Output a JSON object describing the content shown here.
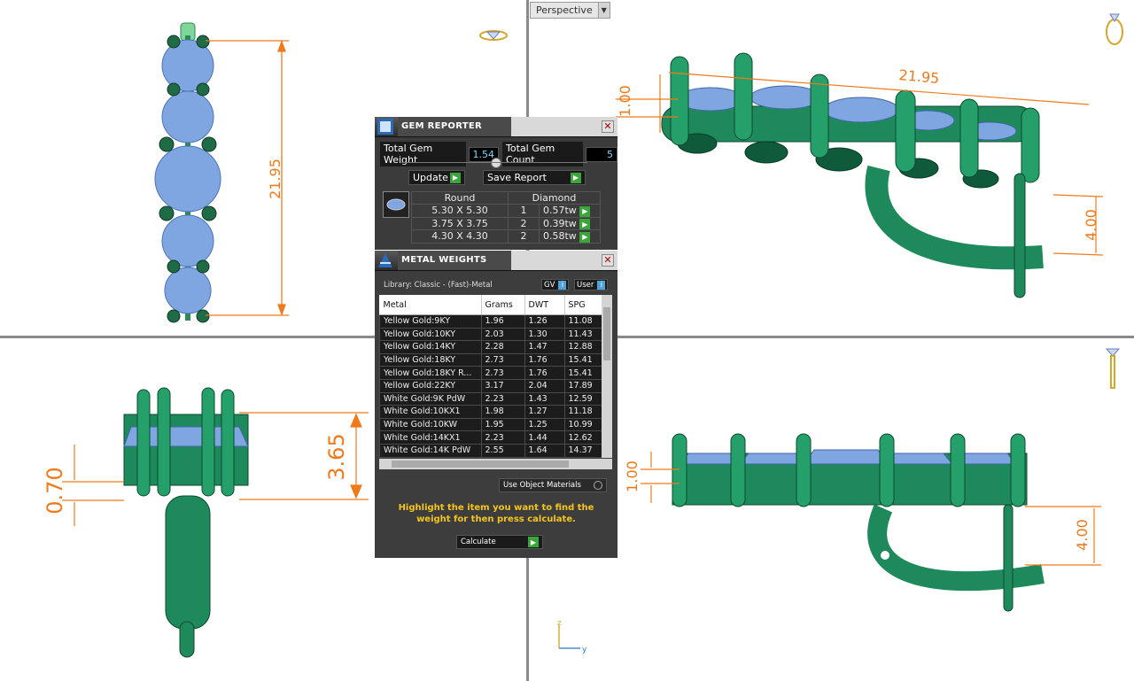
{
  "viewport_label": "Perspective",
  "dimensions": {
    "top_length": "21.95",
    "persp_length": "21.95",
    "persp_small": "1.00",
    "persp_right": "4.00",
    "side_left": "0.70",
    "side_right": "3.65",
    "front_small": "1.00",
    "front_right": "4.00"
  },
  "axis": {
    "z": "z",
    "y": "y"
  },
  "gem_reporter": {
    "title": "GEM REPORTER",
    "total_weight_label": "Total Gem Weight",
    "total_weight": "1.54",
    "total_count_label": "Total Gem Count",
    "total_count": "5",
    "update_label": "Update",
    "save_label": "Save Report",
    "shape": "Round",
    "material": "Diamond",
    "rows": [
      {
        "size": "5.30 X 5.30",
        "qty": "1",
        "weight": "0.57tw"
      },
      {
        "size": "3.75 X 3.75",
        "qty": "2",
        "weight": "0.39tw"
      },
      {
        "size": "4.30 X 4.30",
        "qty": "2",
        "weight": "0.58tw"
      }
    ]
  },
  "metal_weights": {
    "title": "METAL WEIGHTS",
    "library": "Library: Classic - (Fast)-Metal",
    "gv_label": "GV",
    "user_label": "User",
    "columns": [
      "Metal",
      "Grams",
      "DWT",
      "SPG"
    ],
    "rows": [
      [
        "Yellow Gold:9KY",
        "1.96",
        "1.26",
        "11.08"
      ],
      [
        "Yellow Gold:10KY",
        "2.03",
        "1.30",
        "11.43"
      ],
      [
        "Yellow Gold:14KY",
        "2.28",
        "1.47",
        "12.88"
      ],
      [
        "Yellow Gold:18KY",
        "2.73",
        "1.76",
        "15.41"
      ],
      [
        "Yellow Gold:18KY R...",
        "2.73",
        "1.76",
        "15.41"
      ],
      [
        "Yellow Gold:22KY",
        "3.17",
        "2.04",
        "17.89"
      ],
      [
        "White Gold:9K PdW",
        "2.23",
        "1.43",
        "12.59"
      ],
      [
        "White Gold:10KX1",
        "1.98",
        "1.27",
        "11.18"
      ],
      [
        "White Gold:10KW",
        "1.95",
        "1.25",
        "10.99"
      ],
      [
        "White Gold:14KX1",
        "2.23",
        "1.44",
        "12.62"
      ],
      [
        "White Gold:14K PdW",
        "2.55",
        "1.64",
        "14.37"
      ]
    ],
    "use_object_materials": "Use Object Materials",
    "instructions": "Highlight the item you want to find the weight for then press calculate.",
    "calculate_label": "Calculate"
  },
  "colors": {
    "metal_green": "#1e8a5c",
    "gem_blue": "#7fa6e0",
    "dimension_orange": "#f07a1a",
    "instruction_yellow": "#f5c518"
  }
}
